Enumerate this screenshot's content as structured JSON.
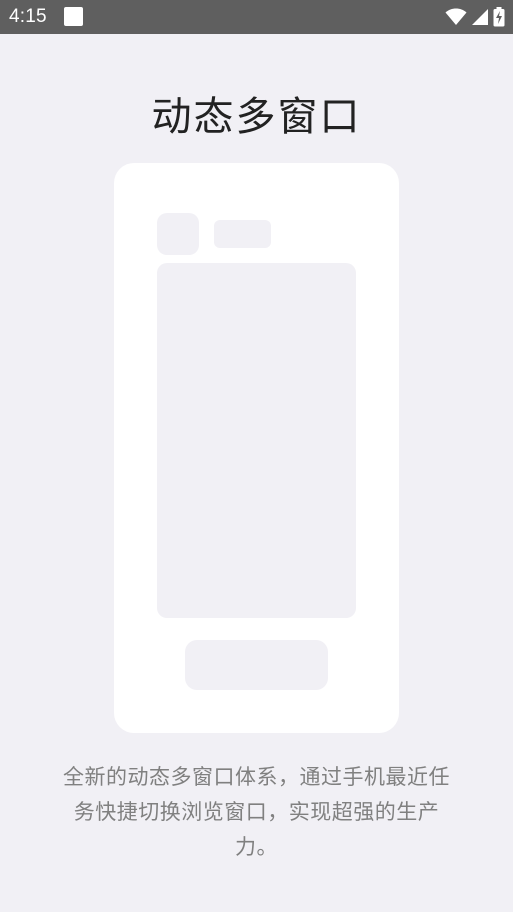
{
  "status_bar": {
    "time": "4:15",
    "icons": [
      "notification-square-icon",
      "wifi-icon",
      "cellular-signal-icon",
      "battery-charging-icon"
    ]
  },
  "page": {
    "title": "动态多窗口",
    "description": "全新的动态多窗口体系，通过手机最近任务快捷切换浏览窗口，实现超强的生产力。"
  },
  "colors": {
    "status_bar_bg": "#5f5f5f",
    "page_bg": "#f1f0f5",
    "card_bg": "#ffffff",
    "title_text": "#222222",
    "description_text": "#808080"
  }
}
